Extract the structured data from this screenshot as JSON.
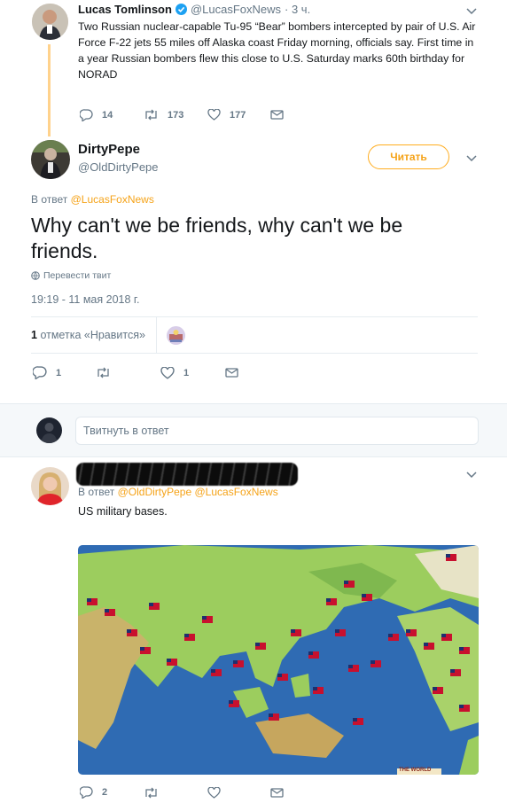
{
  "tweet1": {
    "author_name": "Lucas Tomlinson",
    "author_handle": "@LucasFoxNews",
    "time": "· 3 ч.",
    "text": "Two Russian nuclear-capable Tu-95 “Bear” bombers intercepted by pair of U.S. Air Force F-22 jets 55 miles off Alaska coast Friday morning, officials say. First time in a year Russian bombers flew this close to U.S. Saturday marks 60th birthday for NORAD",
    "replies": "14",
    "retweets": "173",
    "likes": "177",
    "verified": true
  },
  "main_tweet": {
    "author_name": "DirtyPepe",
    "author_handle": "@OldDirtyPepe",
    "follow_label": "Читать",
    "reply_prefix": "В ответ",
    "reply_to": "@LucasFoxNews",
    "text": "Why can't we be friends, why can't we be friends.",
    "translate_label": "Перевести твит",
    "timestamp": "19:19 - 11 мая 2018 г.",
    "like_count": "1",
    "like_label": "отметка «Нравится»",
    "replies": "1",
    "retweets": "",
    "likes": "1"
  },
  "reply_box": {
    "placeholder": "Твитнуть в ответ"
  },
  "reply_tweet": {
    "reply_prefix": "В ответ",
    "reply_to_1": "@OldDirtyPepe",
    "reply_to_2": "@LucasFoxNews",
    "text": "US military bases.",
    "image_caption": "THE WORLD",
    "replies": "2",
    "retweets": "",
    "likes": ""
  },
  "colors": {
    "accent": "#1da1f2",
    "follow_border": "#ffad1f",
    "thread_line": "#ffd28c",
    "ocean": "#2f6bb3",
    "land": "#9ccd5e"
  }
}
